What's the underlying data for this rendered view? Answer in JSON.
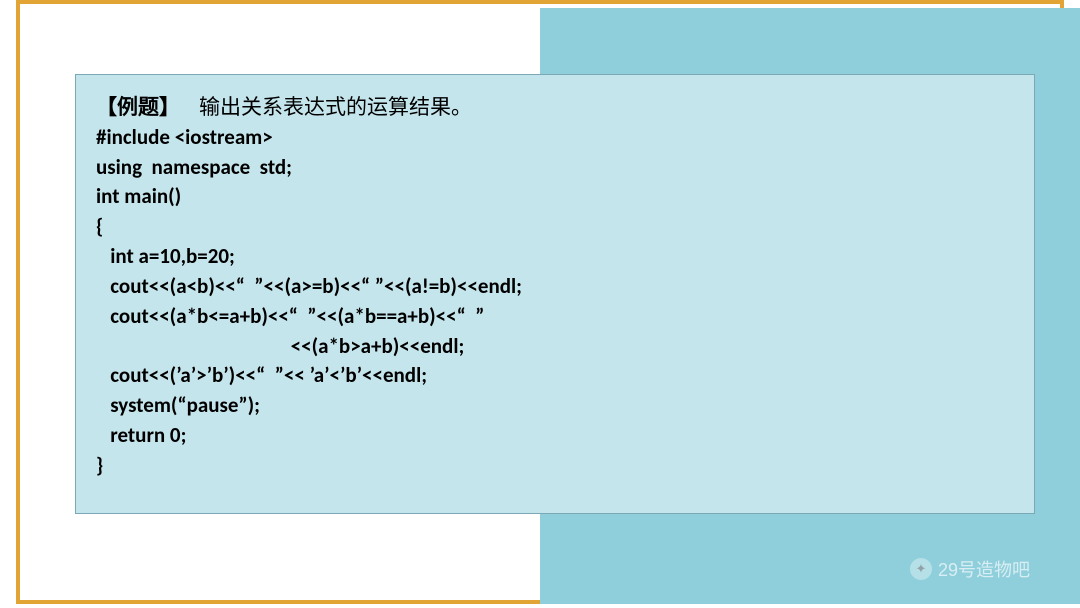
{
  "slide": {
    "title_prefix": "【例题】",
    "title_spaces": "    ",
    "title_text": "输出关系表达式的运算结果。",
    "code_lines": [
      "#include <iostream>",
      "using  namespace  std;",
      "int main()",
      "{",
      "   int a=10,b=20;",
      "   cout<<(a<b)<<“  ”<<(a>=b)<<“ ”<<(a!=b)<<endl;",
      "   cout<<(a*b<=a+b)<<“  ”<<(a*b==a+b)<<“  ”",
      "                                         <<(a*b>a+b)<<endl;",
      "   cout<<(’a’>’b’)<<“  ”<< ’a’<’b’<<endl;",
      "   system(“pause”);",
      "   return 0;",
      "}"
    ]
  },
  "watermark": {
    "text": "29号造物吧"
  }
}
